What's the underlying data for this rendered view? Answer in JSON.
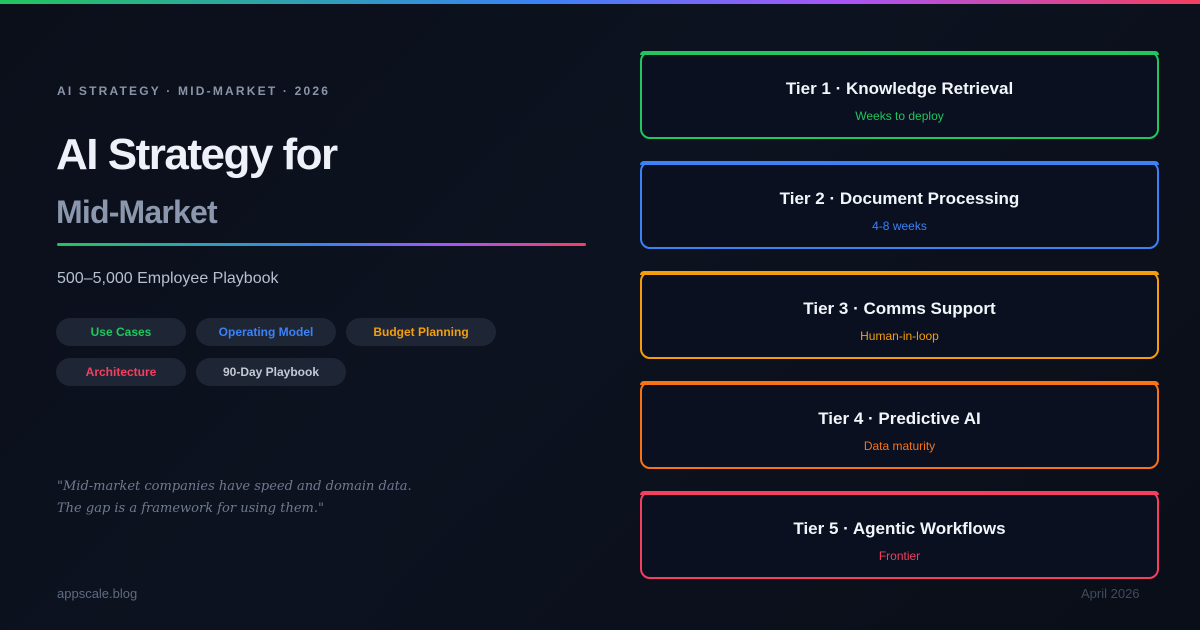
{
  "kicker": "AI STRATEGY · MID-MARKET · 2026",
  "title_line1": "AI Strategy for",
  "title_line2": "Mid-Market",
  "subtitle": "500–5,000 Employee Playbook",
  "tags": [
    {
      "label": "Use Cases",
      "color": "#22c55e"
    },
    {
      "label": "Operating Model",
      "color": "#3b82f6"
    },
    {
      "label": "Budget Planning",
      "color": "#f59e0b"
    },
    {
      "label": "Architecture",
      "color": "#f43f5e"
    },
    {
      "label": "90-Day Playbook",
      "color": "#c3cad6"
    }
  ],
  "quote_line1": "\"Mid-market companies have speed and domain data.",
  "quote_line2": "The gap is a framework for using them.\"",
  "footer_left": "appscale.blog",
  "footer_right": "April 2026",
  "tiers": [
    {
      "name": "Tier 1 · Knowledge Retrieval",
      "sub": "Weeks to deploy",
      "color": "#22c55e"
    },
    {
      "name": "Tier 2 · Document Processing",
      "sub": "4-8 weeks",
      "color": "#3b82f6"
    },
    {
      "name": "Tier 3 · Comms Support",
      "sub": "Human-in-loop",
      "color": "#f59e0b"
    },
    {
      "name": "Tier 4 · Predictive AI",
      "sub": "Data maturity",
      "color": "#f97316"
    },
    {
      "name": "Tier 5 · Agentic Workflows",
      "sub": "Frontier",
      "color": "#f43f5e"
    }
  ]
}
